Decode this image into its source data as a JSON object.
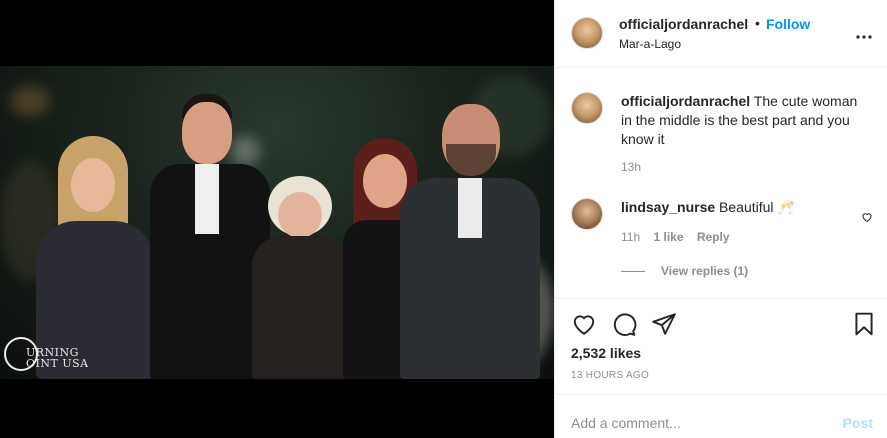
{
  "header": {
    "username": "officialjordanrachel",
    "separator": "•",
    "follow_label": "Follow",
    "location": "Mar-a-Lago",
    "more_icon": "more-horizontal-icon"
  },
  "photo": {
    "watermark_line1": "URNING",
    "watermark_line2": "OINT USA"
  },
  "comments": [
    {
      "username": "officialjordanrachel",
      "text": "The cute woman in the middle is the best part and you know it",
      "time": "13h"
    },
    {
      "username": "lindsay_nurse",
      "text": "Beautiful 🥂",
      "time": "11h",
      "likes": "1 like",
      "reply_label": "Reply",
      "view_replies": "View replies (1)"
    }
  ],
  "actions": {
    "likes": "2,532 likes",
    "timestamp": "13 HOURS AGO"
  },
  "add_comment": {
    "placeholder": "Add a comment...",
    "post_label": "Post"
  },
  "colors": {
    "accent": "#0095f6",
    "post_disabled": "#b2dffc",
    "muted": "#8e8e8e",
    "border": "#efefef"
  }
}
